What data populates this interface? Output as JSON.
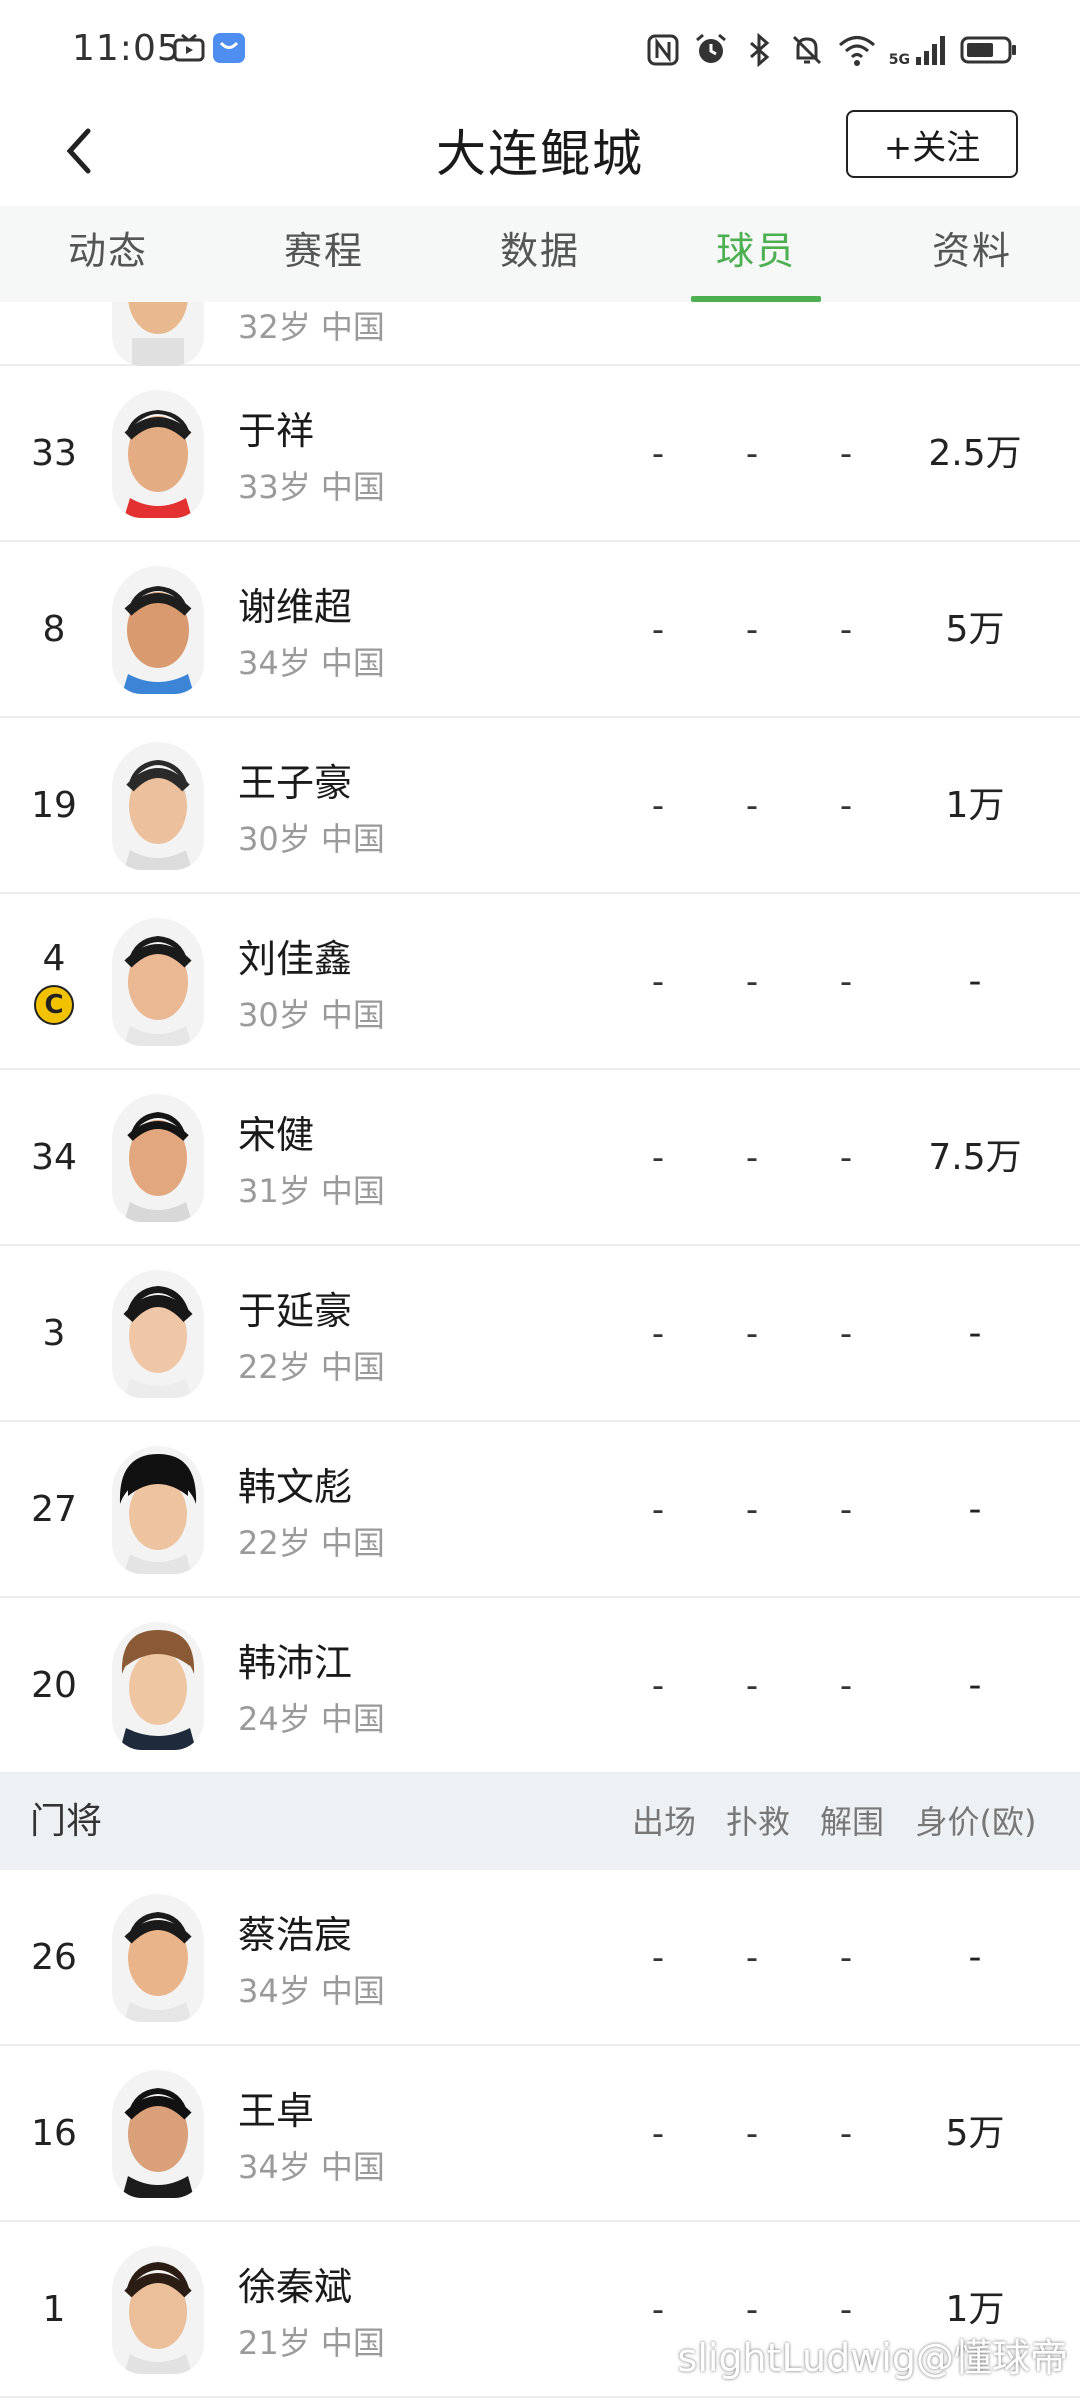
{
  "status_bar": {
    "time": "11:05",
    "network": "5G"
  },
  "header": {
    "title": "大连鲲城",
    "follow_label": "+关注"
  },
  "tabs": [
    {
      "label": "动态"
    },
    {
      "label": "赛程"
    },
    {
      "label": "数据"
    },
    {
      "label": "球员"
    },
    {
      "label": "资料"
    }
  ],
  "active_tab": "球员",
  "partial_row": {
    "info": "32岁 中国"
  },
  "players": [
    {
      "number": "33",
      "name": "于祥",
      "info": "33岁 中国",
      "s1": "-",
      "s2": "-",
      "s3": "-",
      "value": "2.5万",
      "captain": false
    },
    {
      "number": "8",
      "name": "谢维超",
      "info": "34岁 中国",
      "s1": "-",
      "s2": "-",
      "s3": "-",
      "value": "5万",
      "captain": false
    },
    {
      "number": "19",
      "name": "王子豪",
      "info": "30岁 中国",
      "s1": "-",
      "s2": "-",
      "s3": "-",
      "value": "1万",
      "captain": false
    },
    {
      "number": "4",
      "name": "刘佳鑫",
      "info": "30岁 中国",
      "s1": "-",
      "s2": "-",
      "s3": "-",
      "value": "-",
      "captain": true,
      "captain_mark": "C"
    },
    {
      "number": "34",
      "name": "宋健",
      "info": "31岁 中国",
      "s1": "-",
      "s2": "-",
      "s3": "-",
      "value": "7.5万",
      "captain": false
    },
    {
      "number": "3",
      "name": "于延豪",
      "info": "22岁 中国",
      "s1": "-",
      "s2": "-",
      "s3": "-",
      "value": "-",
      "captain": false
    },
    {
      "number": "27",
      "name": "韩文彪",
      "info": "22岁 中国",
      "s1": "-",
      "s2": "-",
      "s3": "-",
      "value": "-",
      "captain": false
    },
    {
      "number": "20",
      "name": "韩沛江",
      "info": "24岁 中国",
      "s1": "-",
      "s2": "-",
      "s3": "-",
      "value": "-",
      "captain": false
    }
  ],
  "goalkeeper_section": {
    "title": "门将",
    "columns": [
      "出场",
      "扑救",
      "解围",
      "身价(欧)"
    ]
  },
  "goalkeepers": [
    {
      "number": "26",
      "name": "蔡浩宸",
      "info": "34岁 中国",
      "s1": "-",
      "s2": "-",
      "s3": "-",
      "value": "-"
    },
    {
      "number": "16",
      "name": "王卓",
      "info": "34岁 中国",
      "s1": "-",
      "s2": "-",
      "s3": "-",
      "value": "5万"
    },
    {
      "number": "1",
      "name": "徐秦斌",
      "info": "21岁 中国",
      "s1": "-",
      "s2": "-",
      "s3": "-",
      "value": "1万"
    }
  ],
  "watermark": "slightLudwig@懂球帝",
  "colors": {
    "accent": "#4caf50",
    "captain_badge": "#f2c200",
    "section_bg": "#eef1f3"
  },
  "icons": [
    "back-arrow-icon",
    "nfc-icon",
    "alarm-icon",
    "bluetooth-icon",
    "mute-icon",
    "wifi-icon",
    "signal-icon",
    "battery-icon",
    "captain-badge-icon",
    "avatar-icon"
  ]
}
